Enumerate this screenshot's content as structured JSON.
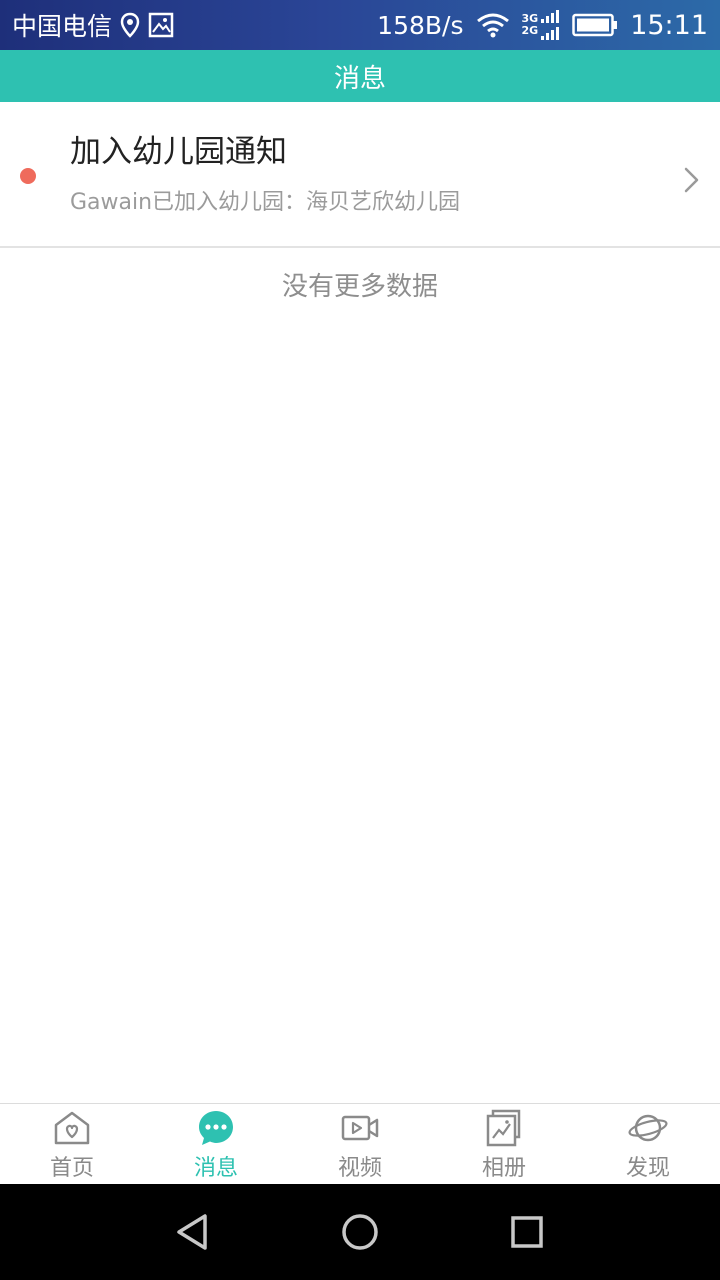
{
  "status_bar": {
    "carrier": "中国电信",
    "net_speed": "158B/s",
    "net_type_top": "3G",
    "net_type_bottom": "2G",
    "time": "15:11",
    "icons": [
      "location-icon",
      "image-icon",
      "wifi-icon",
      "signal-icon",
      "battery-icon"
    ]
  },
  "header": {
    "title": "消息"
  },
  "messages": [
    {
      "title": "加入幼儿园通知",
      "preview": "Gawain已加入幼儿园：海贝艺欣幼儿园",
      "unread": true
    }
  ],
  "list_footer": "没有更多数据",
  "tabs": [
    {
      "label": "首页",
      "icon": "home-icon",
      "active": false
    },
    {
      "label": "消息",
      "icon": "message-icon",
      "active": true
    },
    {
      "label": "视频",
      "icon": "video-icon",
      "active": false
    },
    {
      "label": "相册",
      "icon": "album-icon",
      "active": false
    },
    {
      "label": "发现",
      "icon": "discover-icon",
      "active": false
    }
  ],
  "colors": {
    "accent": "#2ec1b1",
    "unread_dot": "#ef6b5c",
    "inactive_tab": "#8a8a8a"
  }
}
